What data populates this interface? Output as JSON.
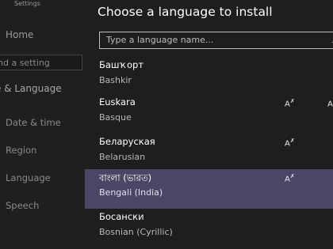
{
  "sidebar": {
    "title": "Settings",
    "home": "Home",
    "search_placeholder": "nd a setting",
    "section": "e & Language",
    "items": [
      {
        "label": "Date & time"
      },
      {
        "label": "Region"
      },
      {
        "label": "Language"
      },
      {
        "label": "Speech"
      }
    ]
  },
  "panel": {
    "title": "Choose a language to install",
    "search_placeholder": "Type a language name...",
    "search_icon": "search-icon",
    "feature_glyph": "A",
    "feature_icon": "handwriting-icon",
    "languages": [
      {
        "native": "Башҡорт",
        "english": "Bashkir",
        "selected": false,
        "features": 0
      },
      {
        "native": "Euskara",
        "english": "Basque",
        "selected": false,
        "features": 2
      },
      {
        "native": "Беларуская",
        "english": "Belarusian",
        "selected": false,
        "features": 1
      },
      {
        "native": "বাংলা (ভারত)",
        "english": "Bengali (India)",
        "selected": true,
        "features": 1
      },
      {
        "native": "Босански",
        "english": "Bosnian (Cyrillic)",
        "selected": false,
        "features": 0
      }
    ],
    "colors": {
      "selected_row": "#4a4766"
    }
  }
}
